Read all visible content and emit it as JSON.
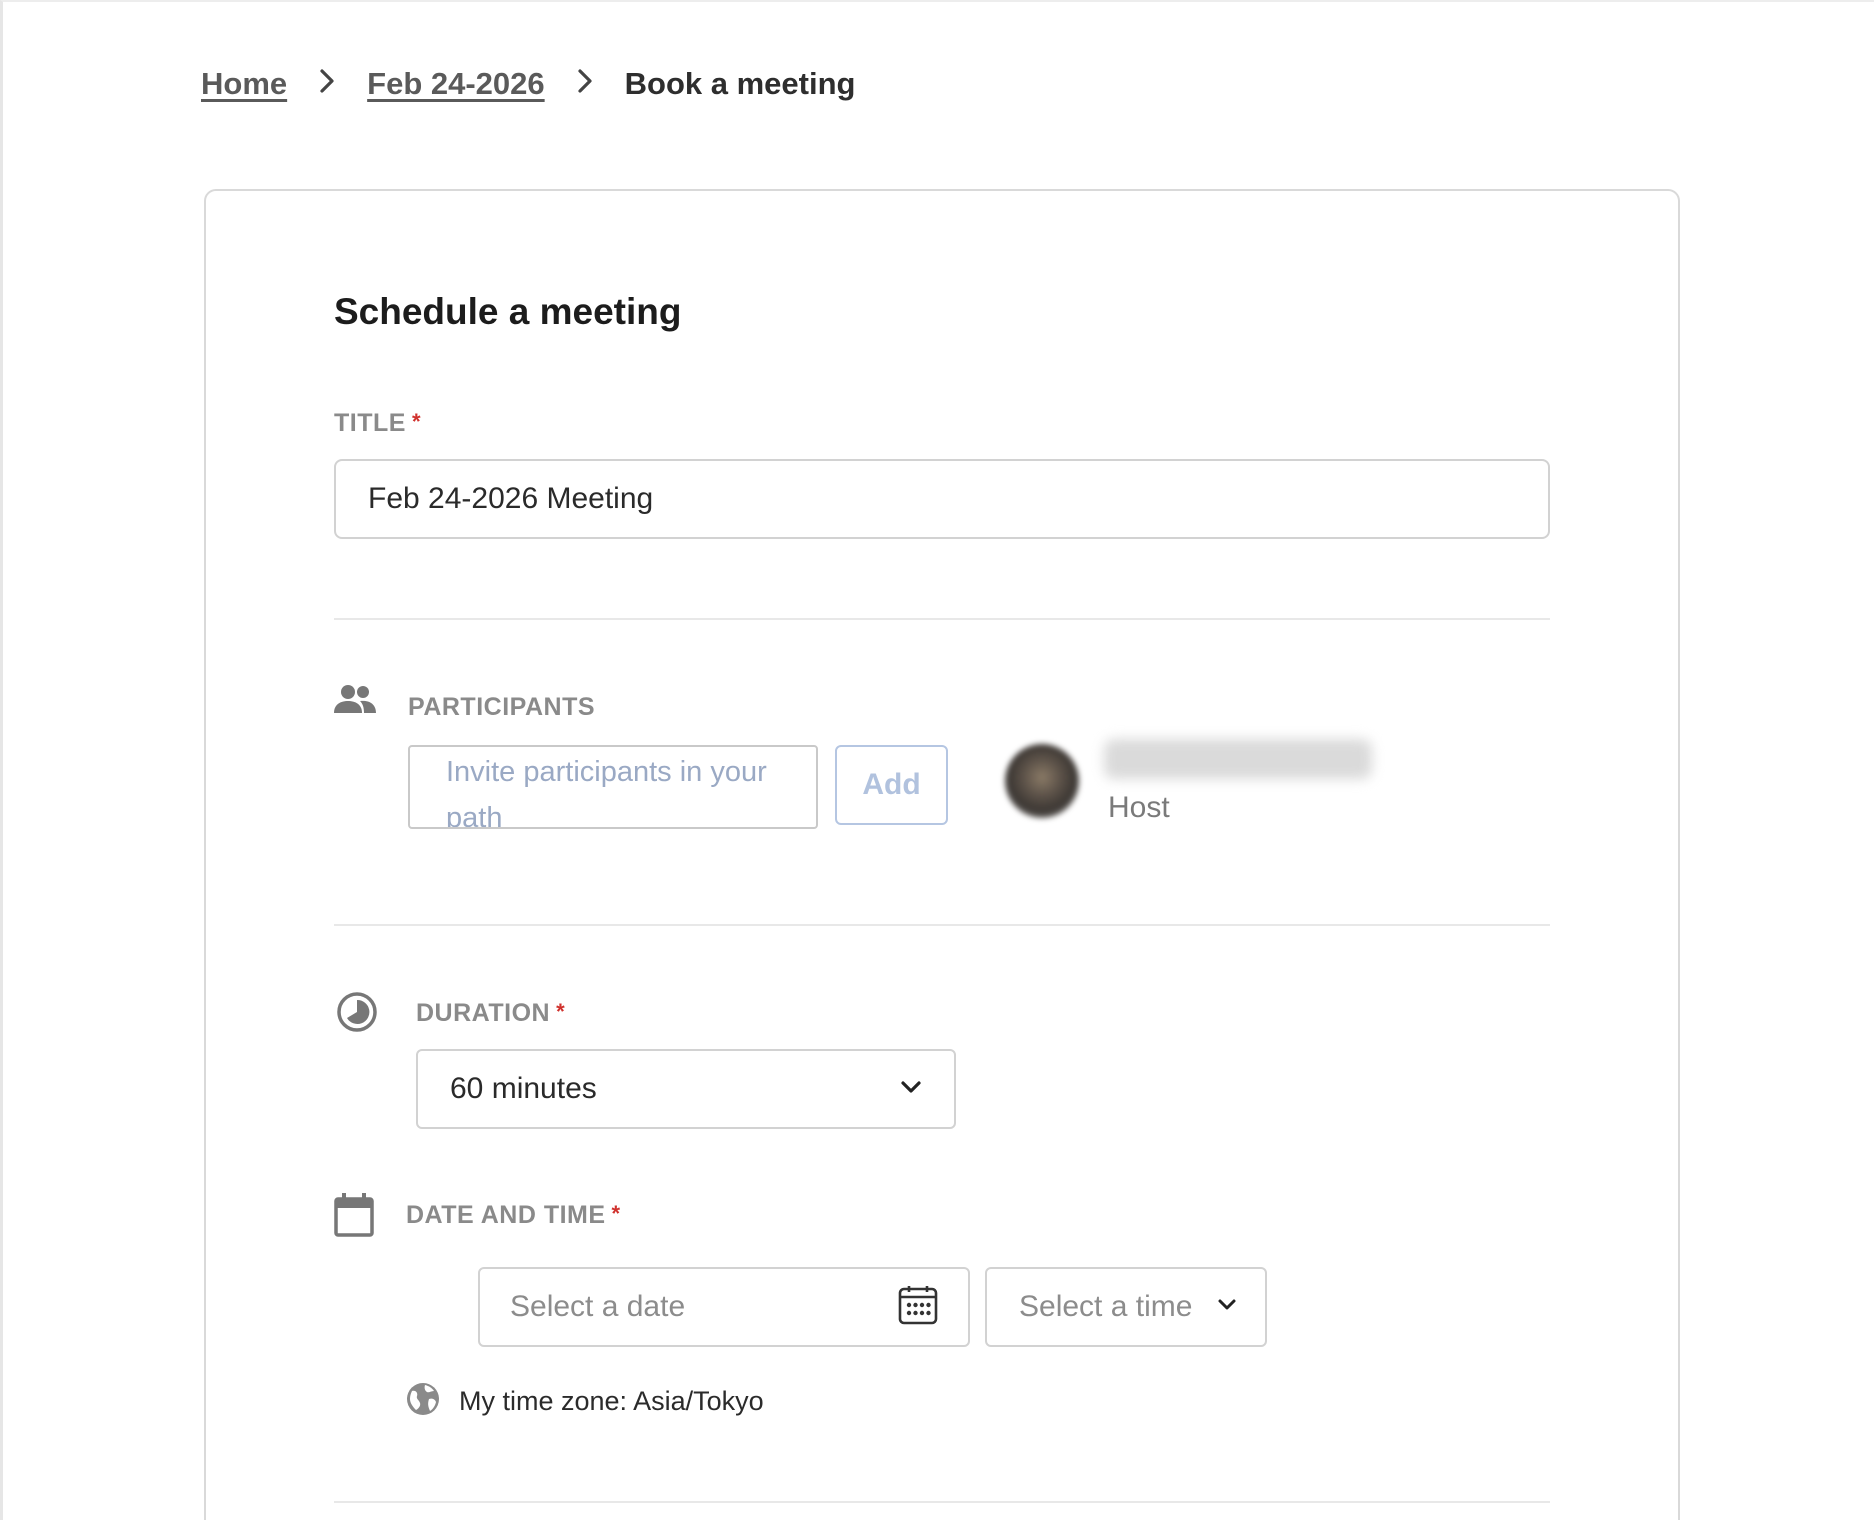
{
  "breadcrumb": {
    "home": "Home",
    "parent": "Feb 24-2026",
    "current": "Book a meeting"
  },
  "form": {
    "heading": "Schedule a meeting",
    "title": {
      "label": "TITLE",
      "required_mark": "*",
      "value": "Feb 24-2026 Meeting"
    },
    "participants": {
      "label": "PARTICIPANTS",
      "input_placeholder": "Invite participants in your path",
      "add_label": "Add",
      "host_role": "Host"
    },
    "duration": {
      "label": "DURATION",
      "required_mark": "*",
      "selected": "60 minutes"
    },
    "datetime": {
      "label": "DATE AND TIME",
      "required_mark": "*",
      "date_placeholder": "Select a date",
      "time_placeholder": "Select a time",
      "timezone": "My time zone: Asia/Tokyo"
    }
  },
  "icons": {
    "participants": "people-icon",
    "duration": "clock-icon",
    "date": "calendar-icon",
    "date_picker": "calendar-grid-icon",
    "timezone": "globe-icon",
    "dropdown": "chevron-down-icon",
    "breadcrumb_separator": "chevron-right-icon"
  },
  "colors": {
    "required": "#d0312d",
    "add_button": "#b1c2de",
    "placeholder": "#9aa9c4"
  }
}
